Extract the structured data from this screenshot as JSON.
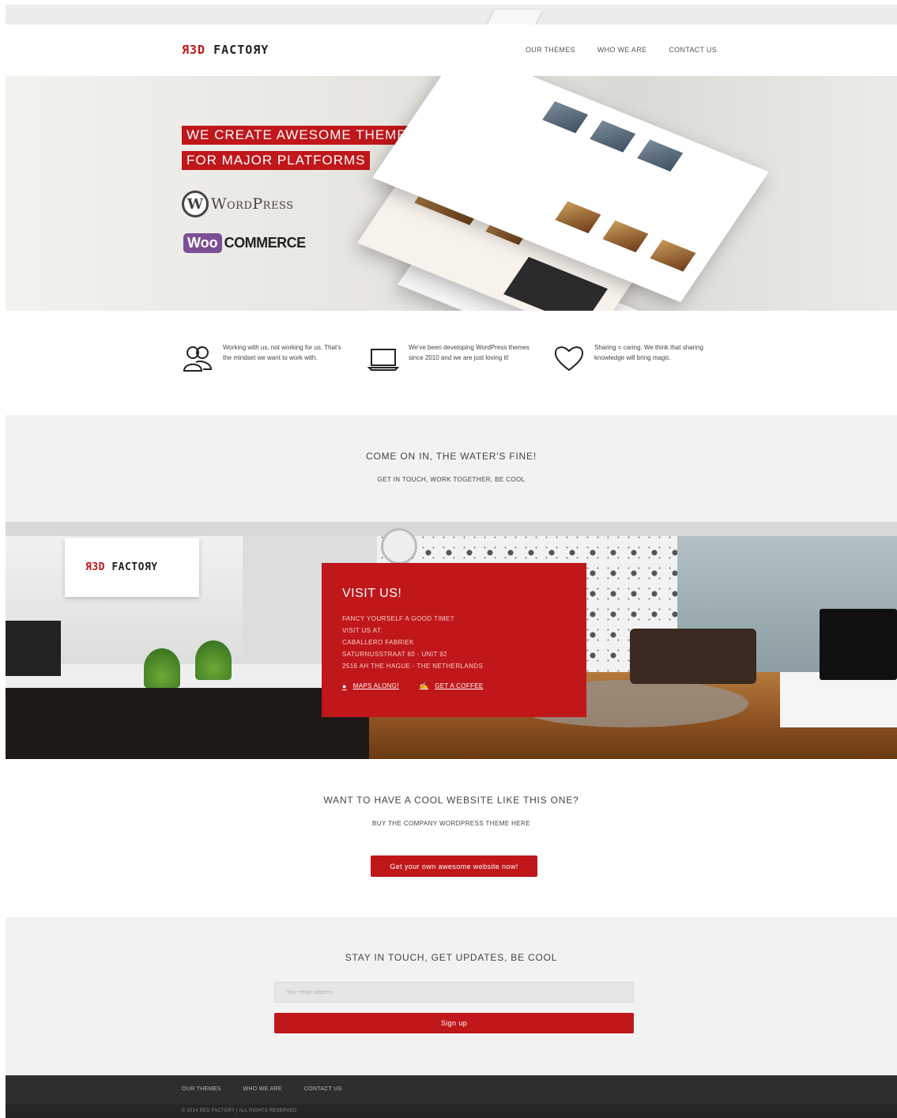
{
  "header": {
    "logo_red": "ЯЗD",
    "logo_dark": "FACTOЯY",
    "nav": [
      "OUR THEMES",
      "WHO WE ARE",
      "CONTACT US"
    ]
  },
  "hero": {
    "line1": "WE CREATE AWESOME THEMES",
    "line2": "FOR MAJOR PLATFORMS",
    "wordpress_mark": "W",
    "wordpress": "WordPress",
    "woo_bubble": "Woo",
    "woo_text": "COMMERCE"
  },
  "features": [
    {
      "icon": "users-icon",
      "text": "Working with us, not working for us. That's the mindset we want to work with."
    },
    {
      "icon": "laptop-icon",
      "text": "We've been developing WordPress themes since 2010 and we are just loving it!"
    },
    {
      "icon": "heart-icon",
      "text": "Sharing = caring. We think that sharing knowledge will bring magic."
    }
  ],
  "invite": {
    "title": "COME ON IN, THE WATER'S FINE!",
    "subtitle": "GET IN TOUCH, WORK TOGETHER, BE COOL"
  },
  "office": {
    "sign_red": "ЯЗD",
    "sign_dark": "FACTOЯY"
  },
  "visit": {
    "title": "VISIT US!",
    "lines": [
      "FANCY YOURSELF A GOOD TIME?",
      "VISIT US AT:",
      "CABALLERO FABRIEK",
      "SATURNUSSTRAAT 60 - UNIT 92",
      "2516 AH THE HAGUE - THE NETHERLANDS"
    ],
    "maps_label": "MAPS ALONG!",
    "coffee_label": " GET A COFFEE"
  },
  "cta": {
    "title": "WANT TO HAVE A COOL WEBSITE LIKE THIS ONE?",
    "subtitle": "BUY THE COMPANY WORDPRESS THEME HERE",
    "button": "Get your own awesome website now!"
  },
  "newsletter": {
    "title": "STAY IN TOUCH, GET UPDATES, BE COOL",
    "placeholder": "Your email address",
    "button": "Sign up"
  },
  "footer": {
    "nav": [
      "OUR THEMES",
      "WHO WE ARE",
      "CONTACT US"
    ],
    "copyright": "© 2014 RED FACTORY | ALL RIGHTS RESERVED"
  },
  "colors": {
    "brand_red": "#c0171b",
    "footer_dark": "#2e2e2e",
    "section_gray": "#f2f2f2"
  }
}
